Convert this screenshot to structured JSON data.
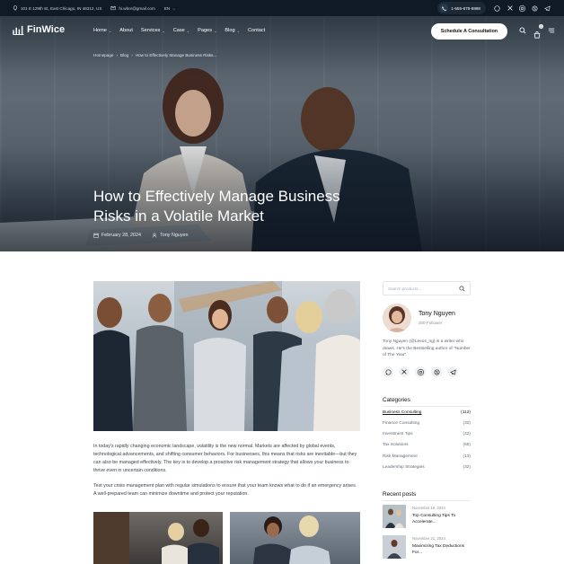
{
  "topbar": {
    "address": "101 E 129th St, East Chicago, IN 46312, US",
    "email": "hi.wbor@gmail.com",
    "language": "EN",
    "phone": "1-555-678-8888",
    "socials": [
      "whatsapp-icon",
      "x-icon",
      "instagram-icon",
      "skype-icon",
      "telegram-icon"
    ]
  },
  "nav": {
    "logo": "FinWice",
    "menu": [
      {
        "label": "Home",
        "dropdown": true
      },
      {
        "label": "About",
        "dropdown": false
      },
      {
        "label": "Services",
        "dropdown": true
      },
      {
        "label": "Case",
        "dropdown": true
      },
      {
        "label": "Pages",
        "dropdown": true
      },
      {
        "label": "Blog",
        "dropdown": true
      },
      {
        "label": "Contact",
        "dropdown": false
      }
    ],
    "cta": "Schedule A Consultation",
    "cart_count": "0"
  },
  "hero": {
    "breadcrumb": [
      "Homepage",
      "Blog",
      "How to Effectively Manage Business Risks..."
    ],
    "title": "How to Effectively Manage Business Risks in a Volatile Market",
    "date": "February 28, 2024",
    "author": "Tony Nguyen"
  },
  "article": {
    "paragraphs": [
      "In today's rapidly changing economic landscape, volatility is the new normal. Markets are affected by global events, technological advancements, and shifting consumer behaviors. For businesses, this means that risks are inevitable—but they can also be managed effectively. The key is to develop a proactive risk management strategy that allows your business to thrive even in uncertain conditions.",
      "Test your crisis management plan with regular simulations to ensure that your team knows what to do if an emergency arises. A well-prepared team can minimize downtime and protect your reputation."
    ]
  },
  "sidebar": {
    "search_placeholder": "Search products...",
    "author": {
      "name": "Tony Nguyen",
      "followers": "200 Follower",
      "bio": "Tony Nguyen (@Leeos_ng) is a writer who draws. He's the Bestselling author of \"Number of The Year\"."
    },
    "socials": [
      "whatsapp-icon",
      "x-icon",
      "instagram-icon",
      "skype-icon",
      "telegram-icon"
    ],
    "categories_title": "Categories",
    "categories": [
      {
        "name": "Business Consulting",
        "count": "(112)",
        "active": true
      },
      {
        "name": "Finance Consulting",
        "count": "(32)",
        "active": false
      },
      {
        "name": "Investment Tips",
        "count": "(42)",
        "active": false
      },
      {
        "name": "Tax Solutions",
        "count": "(65)",
        "active": false
      },
      {
        "name": "Risk Management",
        "count": "(13)",
        "active": false
      },
      {
        "name": "Leadership Strategies",
        "count": "(32)",
        "active": false
      }
    ],
    "recent_title": "Recent posts",
    "recent": [
      {
        "date": "November 16, 2024",
        "title": "Top Consulting Tips To Accelerate..."
      },
      {
        "date": "November 21, 2024",
        "title": "Maximizing Tax Deductions For..."
      }
    ]
  },
  "colors": {
    "topbar_bg": "#0f1a26",
    "text_dark": "#111111",
    "accent_white": "#ffffff"
  }
}
